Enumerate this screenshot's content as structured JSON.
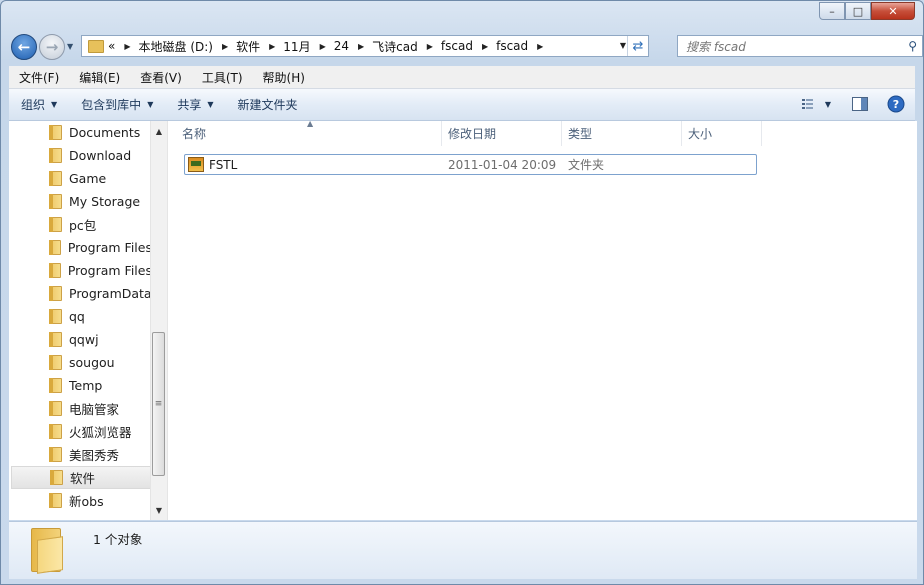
{
  "window": {
    "controls": {
      "minimize": "–",
      "maximize": "□",
      "close": "✕"
    }
  },
  "address": {
    "overflow": "«",
    "crumbs": [
      "本地磁盘 (D:)",
      "软件",
      "11月",
      "24",
      "飞诗cad",
      "fscad",
      "fscad"
    ]
  },
  "search": {
    "placeholder": "搜索 fscad"
  },
  "menu": [
    "文件(F)",
    "编辑(E)",
    "查看(V)",
    "工具(T)",
    "帮助(H)"
  ],
  "toolbar": {
    "organize": "组织",
    "include_library": "包含到库中",
    "share": "共享",
    "new_folder": "新建文件夹",
    "icons": [
      "view-options-icon",
      "preview-pane-icon",
      "help-icon"
    ]
  },
  "nav_tree": [
    "Documents",
    "Download",
    "Game",
    "My Storage",
    "pc包",
    "Program Files",
    "Program Files",
    "ProgramData",
    "qq",
    "qqwj",
    "sougou",
    "Temp",
    "电脑管家",
    "火狐浏览器",
    "美图秀秀",
    "软件",
    "新obs"
  ],
  "nav_selected": "软件",
  "columns": {
    "name": "名称",
    "modified": "修改日期",
    "type": "类型",
    "size": "大小"
  },
  "files": [
    {
      "name": "FSTL",
      "modified": "2011-01-04 20:09",
      "type": "文件夹",
      "size": ""
    }
  ],
  "status": {
    "text": "1 个对象"
  }
}
